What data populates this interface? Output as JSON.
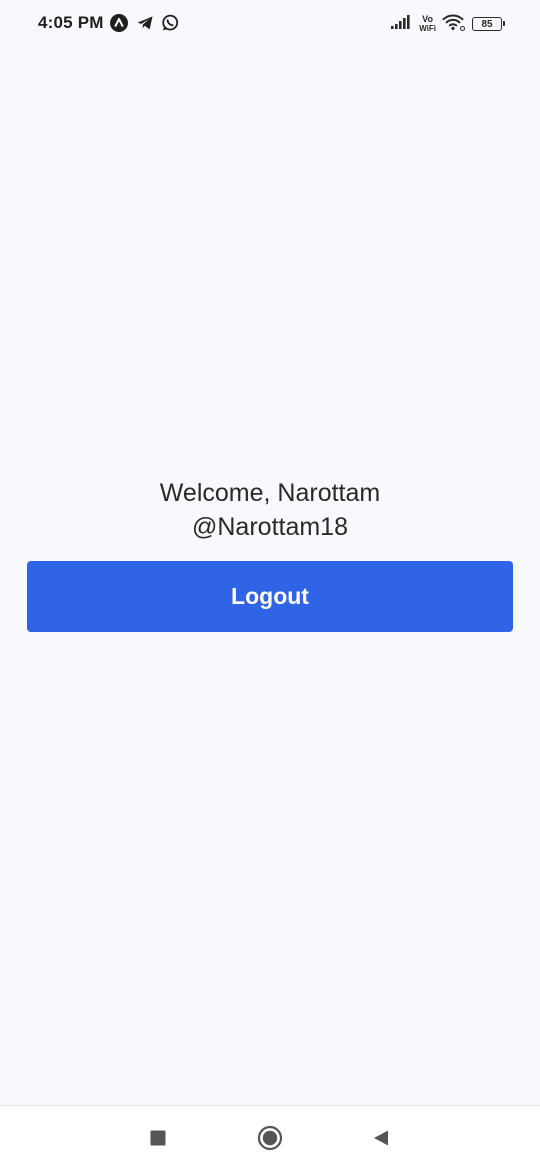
{
  "status_bar": {
    "time": "4:05 PM",
    "left_icons": [
      "app-a-icon",
      "telegram-icon",
      "whatsapp-icon"
    ],
    "right_icons": [
      "signal-icon",
      "vowifi-icon",
      "wifi-icon",
      "battery-icon"
    ],
    "vowifi_top": "Vo",
    "vowifi_bottom": "WiFi",
    "battery_level": "85"
  },
  "main": {
    "welcome_line1": "Welcome, Narottam",
    "welcome_line2": "@Narottam18",
    "logout_label": "Logout"
  },
  "colors": {
    "background": "#f8f9fd",
    "button": "#2f64e6",
    "button_text": "#ffffff"
  },
  "nav_bar": {
    "buttons": [
      "recent-apps-icon",
      "home-icon",
      "back-icon"
    ]
  }
}
